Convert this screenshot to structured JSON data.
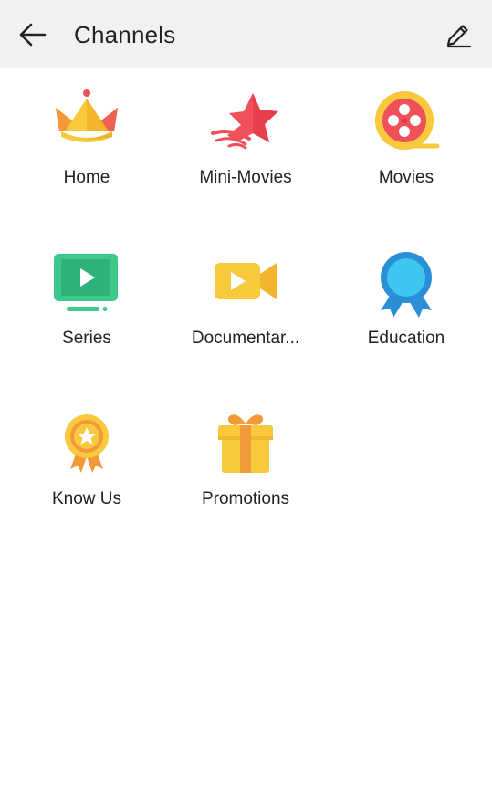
{
  "header": {
    "title": "Channels",
    "back_icon": "arrow-left-icon",
    "edit_icon": "pencil-icon"
  },
  "channels": [
    {
      "label": "Home",
      "icon": "crown-icon"
    },
    {
      "label": "Mini-Movies",
      "icon": "star-icon"
    },
    {
      "label": "Movies",
      "icon": "film-reel-icon"
    },
    {
      "label": "Series",
      "icon": "tv-play-icon"
    },
    {
      "label": "Documentar...",
      "icon": "video-camera-icon"
    },
    {
      "label": "Education",
      "icon": "award-ribbon-icon"
    },
    {
      "label": "Know Us",
      "icon": "medal-star-icon"
    },
    {
      "label": "Promotions",
      "icon": "gift-icon"
    }
  ],
  "colors": {
    "header_bg": "#f1f1f1",
    "text": "#222222",
    "yellow": "#f8c93c",
    "orange": "#f29a38",
    "red": "#f0505a",
    "green": "#3ec88a",
    "cyan": "#3cc7f0",
    "blue": "#2b8fd8"
  }
}
